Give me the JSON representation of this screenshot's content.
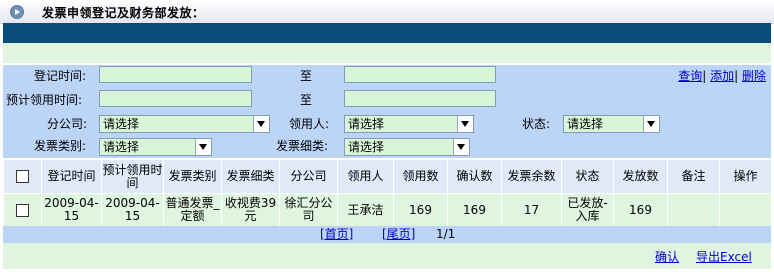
{
  "header": {
    "title": "发票申领登记及财务部发放："
  },
  "filters": {
    "reg_time_label": "登记时间:",
    "to_label_1": "至",
    "plan_time_label": "预计领用时间:",
    "to_label_2": "至",
    "company_label": "分公司:",
    "company_value": "请选择",
    "receiver_label": "领用人:",
    "receiver_value": "请选择",
    "status_label": "状态:",
    "status_value": "请选择",
    "inv_type_label": "发票类别:",
    "inv_type_value": "请选择",
    "inv_detail_label": "发票细类:",
    "inv_detail_value": "请选择"
  },
  "actions": {
    "query": "查询",
    "add": "添加",
    "delete": "删除"
  },
  "table": {
    "columns": [
      "登记时间",
      "预计领用时间",
      "发票类别",
      "发票细类",
      "分公司",
      "领用人",
      "领用数",
      "确认数",
      "发票余数",
      "状态",
      "发放数",
      "备注",
      "操作"
    ],
    "rows": [
      {
        "reg_time": "2009-04-15",
        "plan_time": "2009-04-15",
        "inv_type": "普通发票_定额",
        "inv_detail": "收视费39元",
        "company": "徐汇分公司",
        "receiver": "王承洁",
        "qty": "169",
        "confirmed": "169",
        "remaining": "17",
        "status": "已发放-入库",
        "issued": "169",
        "note": "",
        "op": ""
      }
    ]
  },
  "pager": {
    "first": "[首页]",
    "last": "[尾页]",
    "info": "1/1"
  },
  "footer": {
    "confirm": "确认",
    "export": "导出Excel"
  }
}
